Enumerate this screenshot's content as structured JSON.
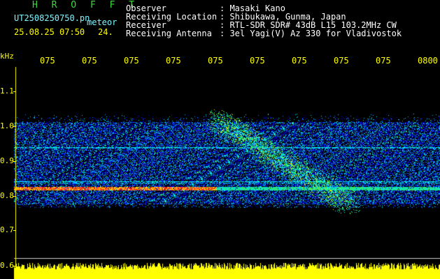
{
  "header": {
    "title": "H R O F F T",
    "filename": "UT2508250750.pn",
    "tag": "meteor",
    "datetime": "25.08.25 07:50",
    "extra": "24.",
    "fields": [
      {
        "label": "Observer",
        "value": ": Masaki Kano"
      },
      {
        "label": "Receiving Location",
        "value": ": Shibukawa, Gunma, Japan"
      },
      {
        "label": "Receiver",
        "value": ": RTL-SDR SDR# 43dB L15 103.2MHz CW"
      },
      {
        "label": "Receiving Antenna",
        "value": ": 3el Yagi(V) Az 330 for Vladivostok"
      }
    ]
  },
  "time_axis": {
    "ticks": [
      "075",
      "075",
      "075",
      "075",
      "075",
      "075",
      "075",
      "075",
      "075",
      "0800"
    ]
  },
  "freq_axis": {
    "unit": "kHz",
    "ticks": [
      "1.1",
      "1.0",
      "0.9",
      "0.8",
      "0.7",
      "0.6"
    ]
  },
  "colors": {
    "axis": "#ffff00",
    "header_text": "#ffffff",
    "title": "#3bdc3b",
    "file_info": "#7ff5ff",
    "background": "#000000"
  }
}
